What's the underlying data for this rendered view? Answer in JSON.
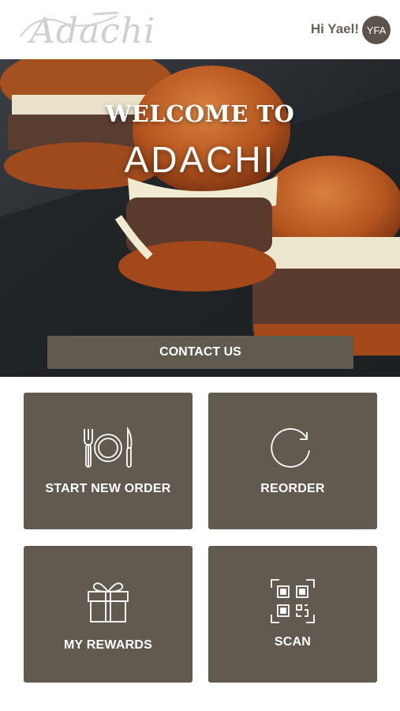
{
  "header": {
    "logo_text": "Adachi",
    "greeting": "Hi Yael!",
    "avatar_initials": "YFA"
  },
  "hero": {
    "welcome": "WELCOME TO",
    "name": "ADACHI",
    "contact_label": "CONTACT US"
  },
  "tiles": [
    {
      "label": "START NEW ORDER",
      "icon": "utensils-plate-icon"
    },
    {
      "label": "REORDER",
      "icon": "refresh-icon"
    },
    {
      "label": "MY REWARDS",
      "icon": "gift-icon"
    },
    {
      "label": "SCAN",
      "icon": "qr-code-icon"
    }
  ],
  "colors": {
    "tile_bg": "#615a4f",
    "avatar_bg": "#5c544a",
    "greeting_text": "#6a625a"
  }
}
